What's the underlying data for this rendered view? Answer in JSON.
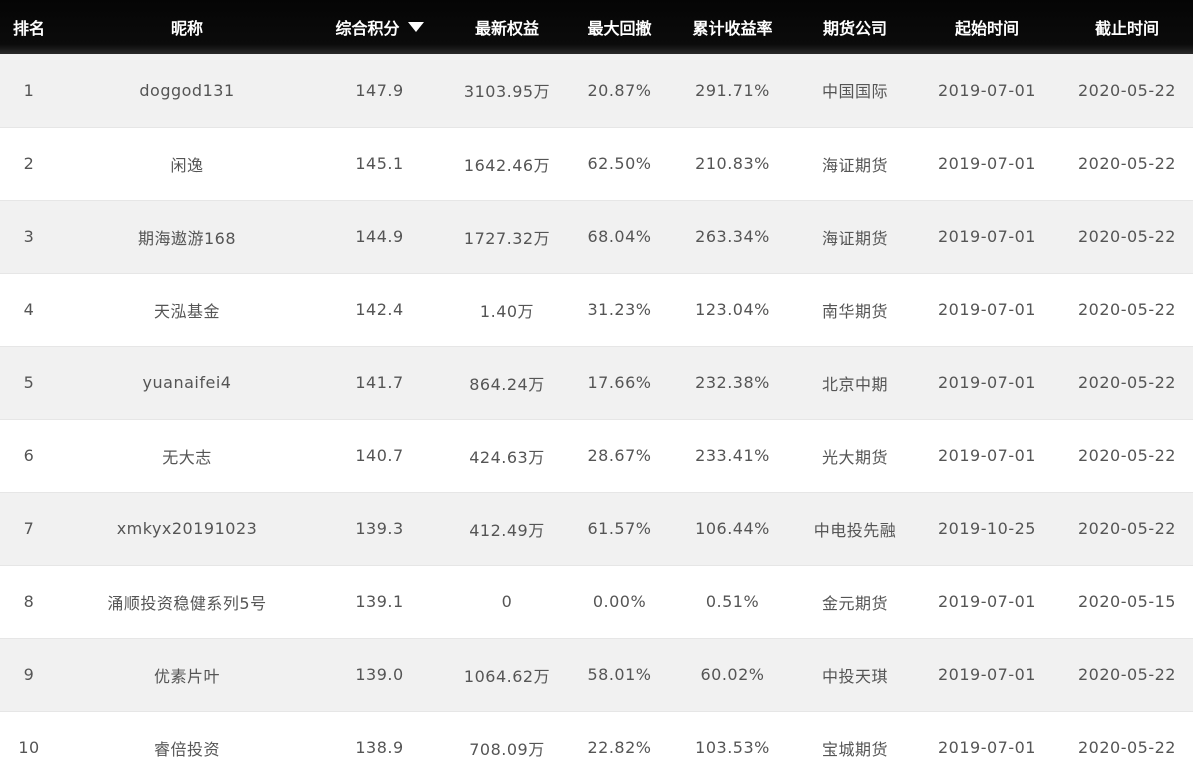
{
  "table": {
    "headers": {
      "rank": "排名",
      "nickname": "昵称",
      "score": "综合积分",
      "equity": "最新权益",
      "max_drawdown": "最大回撤",
      "cum_return": "累计收益率",
      "broker": "期货公司",
      "start_date": "起始时间",
      "end_date": "截止时间"
    },
    "sort": {
      "column": "score",
      "direction": "desc",
      "icon": "sort-down-icon"
    },
    "rows": [
      {
        "rank": "1",
        "nickname": "doggod131",
        "score": "147.9",
        "equity": "3103.95万",
        "max_drawdown": "20.87%",
        "cum_return": "291.71%",
        "broker": "中国国际",
        "start_date": "2019-07-01",
        "end_date": "2020-05-22"
      },
      {
        "rank": "2",
        "nickname": "闲逸",
        "score": "145.1",
        "equity": "1642.46万",
        "max_drawdown": "62.50%",
        "cum_return": "210.83%",
        "broker": "海证期货",
        "start_date": "2019-07-01",
        "end_date": "2020-05-22"
      },
      {
        "rank": "3",
        "nickname": "期海遨游168",
        "score": "144.9",
        "equity": "1727.32万",
        "max_drawdown": "68.04%",
        "cum_return": "263.34%",
        "broker": "海证期货",
        "start_date": "2019-07-01",
        "end_date": "2020-05-22"
      },
      {
        "rank": "4",
        "nickname": "天泓基金",
        "score": "142.4",
        "equity": "1.40万",
        "max_drawdown": "31.23%",
        "cum_return": "123.04%",
        "broker": "南华期货",
        "start_date": "2019-07-01",
        "end_date": "2020-05-22"
      },
      {
        "rank": "5",
        "nickname": "yuanaifei4",
        "score": "141.7",
        "equity": "864.24万",
        "max_drawdown": "17.66%",
        "cum_return": "232.38%",
        "broker": "北京中期",
        "start_date": "2019-07-01",
        "end_date": "2020-05-22"
      },
      {
        "rank": "6",
        "nickname": "无大志",
        "score": "140.7",
        "equity": "424.63万",
        "max_drawdown": "28.67%",
        "cum_return": "233.41%",
        "broker": "光大期货",
        "start_date": "2019-07-01",
        "end_date": "2020-05-22"
      },
      {
        "rank": "7",
        "nickname": "xmkyx20191023",
        "score": "139.3",
        "equity": "412.49万",
        "max_drawdown": "61.57%",
        "cum_return": "106.44%",
        "broker": "中电投先融",
        "start_date": "2019-10-25",
        "end_date": "2020-05-22"
      },
      {
        "rank": "8",
        "nickname": "涌顺投资稳健系列5号",
        "score": "139.1",
        "equity": "0",
        "max_drawdown": "0.00%",
        "cum_return": "0.51%",
        "broker": "金元期货",
        "start_date": "2019-07-01",
        "end_date": "2020-05-15"
      },
      {
        "rank": "9",
        "nickname": "优素片叶",
        "score": "139.0",
        "equity": "1064.62万",
        "max_drawdown": "58.01%",
        "cum_return": "60.02%",
        "broker": "中投天琪",
        "start_date": "2019-07-01",
        "end_date": "2020-05-22"
      },
      {
        "rank": "10",
        "nickname": "睿倍投资",
        "score": "138.9",
        "equity": "708.09万",
        "max_drawdown": "22.82%",
        "cum_return": "103.53%",
        "broker": "宝城期货",
        "start_date": "2019-07-01",
        "end_date": "2020-05-22"
      }
    ]
  }
}
